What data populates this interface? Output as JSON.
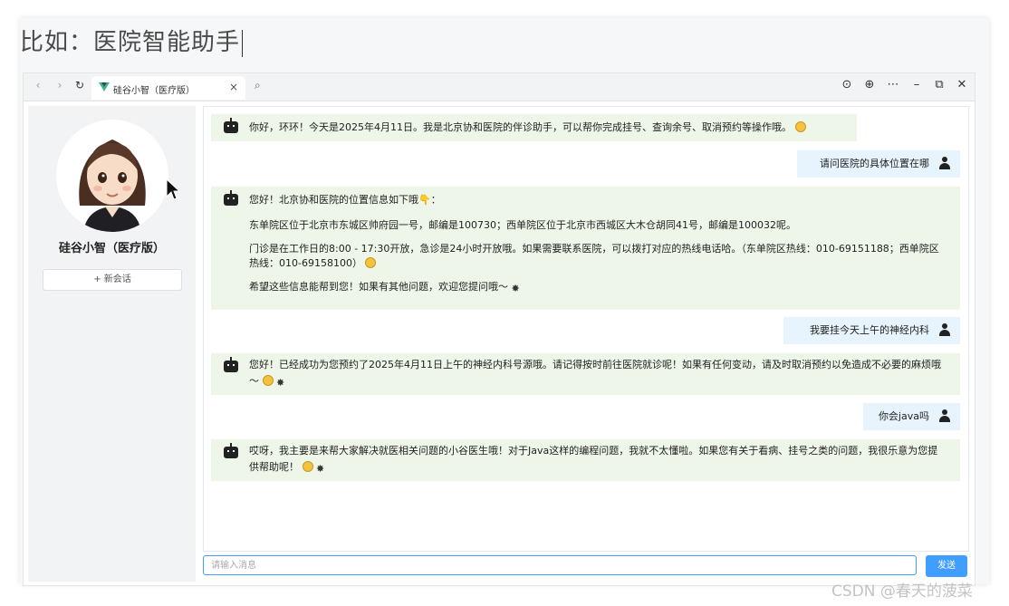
{
  "slide": {
    "title": "比如：医院智能助手"
  },
  "browser": {
    "tab_title": "硅谷小智（医疗版）",
    "tab_close": "×"
  },
  "sidebar": {
    "bot_name": "硅谷小智（医疗版）",
    "new_chat_label": "+ 新会话"
  },
  "messages": [
    {
      "role": "bot",
      "paragraphs": [
        "你好，环环！今天是2025年4月11日。我是北京协和医院的伴诊助手，可以帮你完成挂号、查询余号、取消预约等操作哦。"
      ]
    },
    {
      "role": "user",
      "text": "请问医院的具体位置在哪"
    },
    {
      "role": "bot",
      "paragraphs": [
        "您好！北京协和医院的位置信息如下哦👇：",
        "东单院区位于北京市东城区帅府园一号，邮编是100730；西单院区位于北京市西城区大木仓胡同41号，邮编是100032呢。",
        "门诊是在工作日的8:00 - 17:30开放，急诊是24小时开放哦。如果需要联系医院，可以拨打对应的热线电话哈。（东单院区热线：010-69151188；西单院区热线：010-69158100）",
        "希望这些信息能帮到您！如果有其他问题，欢迎您提问哦～"
      ]
    },
    {
      "role": "user",
      "text": "我要挂今天上午的神经内科"
    },
    {
      "role": "bot",
      "paragraphs": [
        "您好！已经成功为您预约了2025年4月11日上午的神经内科号源哦。请记得按时前往医院就诊呢！如果有任何变动，请及时取消预约以免造成不必要的麻烦哦～"
      ]
    },
    {
      "role": "user",
      "text": "你会java吗"
    },
    {
      "role": "bot",
      "paragraphs": [
        "哎呀，我主要是来帮大家解决就医相关问题的小谷医生哦！对于Java这样的编程问题，我就不太懂啦。如果您有关于看病、挂号之类的问题，我很乐意为您提供帮助呢！"
      ]
    }
  ],
  "input": {
    "placeholder": "请输入消息",
    "send_label": "发送"
  },
  "watermark": "CSDN @春天的菠菜",
  "colors": {
    "accent": "#409eff",
    "bot_bubble": "#eef6e9",
    "user_bubble": "#e8f4fd"
  }
}
